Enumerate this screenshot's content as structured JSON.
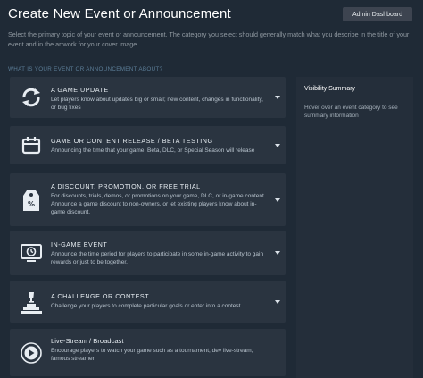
{
  "page": {
    "title": "Create New Event or Announcement",
    "admin_button": "Admin Dashboard",
    "intro": "Select the primary topic of your event or announcement. The category you select should generally match what you describe in the title of your event and in the artwork for your cover image.",
    "section_label": "WHAT IS YOUR EVENT OR ANNOUNCEMENT ABOUT?"
  },
  "categories": [
    {
      "icon": "refresh-arrows-icon",
      "title": "A GAME UPDATE",
      "description": "Let players know about updates big or small; new content, changes in functionality, or bug fixes"
    },
    {
      "icon": "calendar-icon",
      "title": "GAME OR CONTENT RELEASE / BETA TESTING",
      "description": "Announcing the time that your game, Beta, DLC, or Special Season will release"
    },
    {
      "icon": "price-tag-icon",
      "title": "A DISCOUNT, PROMOTION, OR FREE TRIAL",
      "description": "For discounts, trials, demos, or promotions on your game, DLC, or in-game content. Announce a game discount to non-owners, or let existing players know about in-game discount."
    },
    {
      "icon": "monitor-clock-icon",
      "title": "IN-GAME EVENT",
      "description": "Announce the time period for players to participate in some in-game activity to gain rewards or just to be together."
    },
    {
      "icon": "trophy-podium-icon",
      "title": "A CHALLENGE OR CONTEST",
      "description": "Challenge your players to complete particular goals or enter into a contest."
    },
    {
      "icon": "play-broadcast-icon",
      "title": "Live-Stream / Broadcast",
      "description": "Encourage players to watch your game such as a tournament, dev live-stream, famous streamer"
    }
  ],
  "side_panel": {
    "title": "Visibility Summary",
    "text": "Hover over an event category to see summary information"
  },
  "colors": {
    "background": "#1f2a36",
    "card": "#2a3440",
    "side_panel": "#242e3a",
    "section_label": "#5c7e98",
    "admin_button": "#3d4450"
  }
}
